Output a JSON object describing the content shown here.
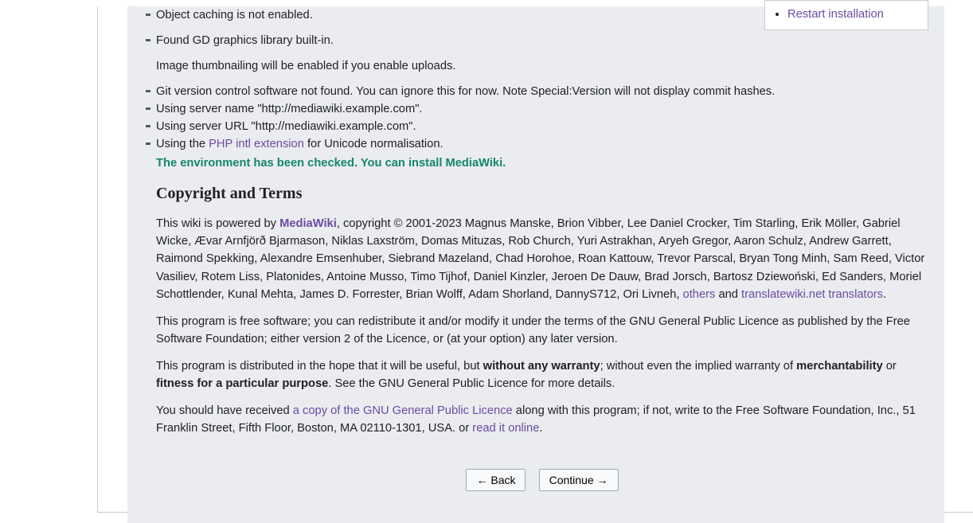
{
  "sidebar": {
    "restart": "Restart installation"
  },
  "checks": {
    "caching": "Object caching is not enabled.",
    "gd": "Found GD graphics library built-in.",
    "gd_sub": "Image thumbnailing will be enabled if you enable uploads.",
    "git": "Git version control software not found. You can ignore this for now. Note Special:Version will not display commit hashes.",
    "server_name": "Using server name \"http://mediawiki.example.com\".",
    "server_url": "Using server URL \"http://mediawiki.example.com\".",
    "intl_pre": "Using the ",
    "intl_link": "PHP intl extension",
    "intl_post": " for Unicode normalisation."
  },
  "success_msg": "The environment has been checked. You can install MediaWiki.",
  "heading": "Copyright and Terms",
  "copyright": {
    "powered_pre": "This wiki is powered by ",
    "mw_link": "MediaWiki",
    "authors": ", copyright © 2001-2023 Magnus Manske, Brion Vibber, Lee Daniel Crocker, Tim Starling, Erik Möller, Gabriel Wicke, Ævar Arnfjörð Bjarmason, Niklas Laxström, Domas Mituzas, Rob Church, Yuri Astrakhan, Aryeh Gregor, Aaron Schulz, Andrew Garrett, Raimond Spekking, Alexandre Emsenhuber, Siebrand Mazeland, Chad Horohoe, Roan Kattouw, Trevor Parscal, Bryan Tong Minh, Sam Reed, Victor Vasiliev, Rotem Liss, Platonides, Antoine Musso, Timo Tijhof, Daniel Kinzler, Jeroen De Dauw, Brad Jorsch, Bartosz Dziewoński, Ed Sanders, Moriel Schottlender, Kunal Mehta, James D. Forrester, Brian Wolff, Adam Shorland, DannyS712, Ori Livneh, ",
    "others": "others",
    "and": " and ",
    "translators": "translatewiki.net translators",
    "period": ".",
    "gpl": "This program is free software; you can redistribute it and/or modify it under the terms of the GNU General Public Licence as published by the Free Software Foundation; either version 2 of the Licence, or (at your option) any later version.",
    "warranty_pre": "This program is distributed in the hope that it will be useful, but ",
    "warranty_b1": "without any warranty",
    "warranty_mid": "; without even the implied warranty of ",
    "warranty_b2": "merchantability",
    "warranty_or": " or ",
    "warranty_b3": "fitness for a particular purpose",
    "warranty_post": ". See the GNU General Public Licence for more details.",
    "receive_pre": "You should have received ",
    "receive_link": "a copy of the GNU General Public Licence",
    "receive_mid": " along with this program; if not, write to the Free Software Foundation, Inc., 51 Franklin Street, Fifth Floor, Boston, MA 02110-1301, USA. or ",
    "receive_link2": "read it online",
    "receive_end": "."
  },
  "buttons": {
    "back": "← Back",
    "continue": "Continue →"
  }
}
